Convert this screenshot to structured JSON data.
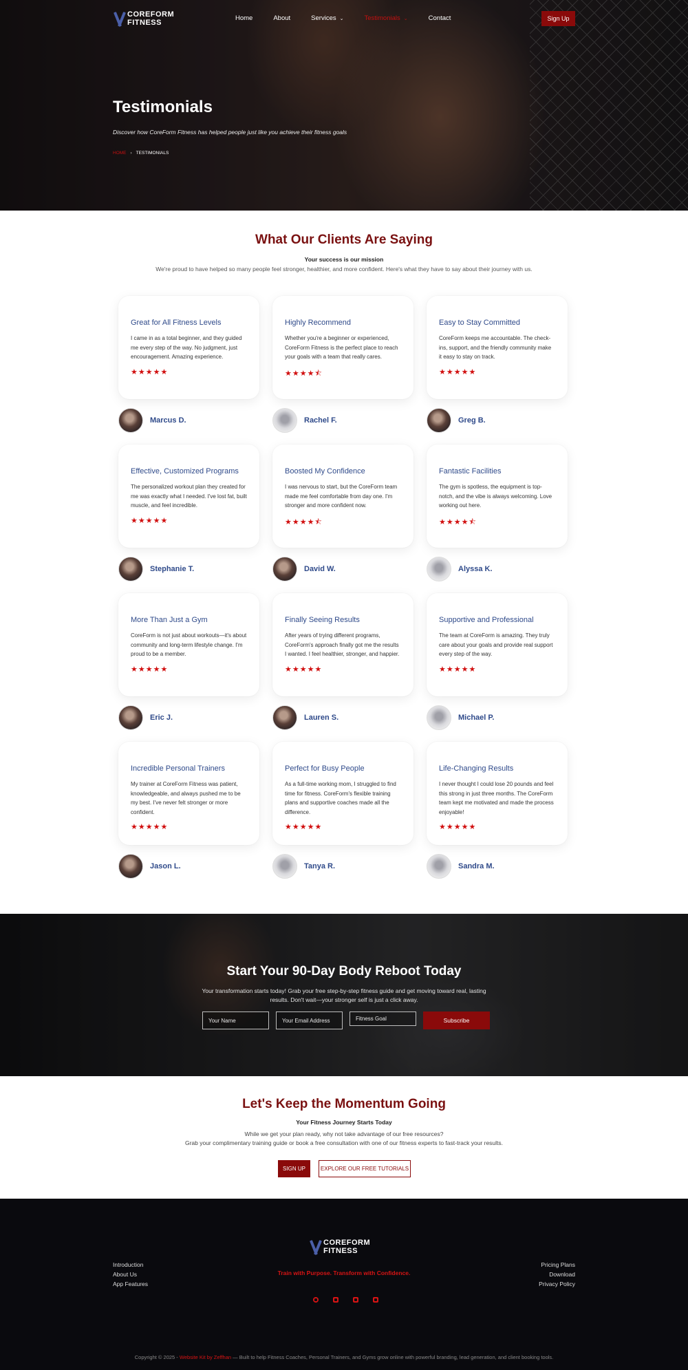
{
  "header": {
    "logo_line1": "COREFORM",
    "logo_line2": "FITNESS",
    "nav": [
      "Home",
      "About",
      "Services",
      "Testimonials",
      "Contact"
    ],
    "signup": "Sign Up"
  },
  "hero": {
    "title": "Testimonials",
    "subtitle": "Discover how CoreForm Fitness has helped people just like you achieve their fitness goals",
    "breadcrumb_home": "HOME",
    "breadcrumb_sep": "›",
    "breadcrumb_current": "TESTIMONIALS"
  },
  "testimonials": {
    "title": "What Our Clients Are Saying",
    "tagline": "Your success is our mission",
    "description": "We're proud to have helped so many people feel stronger, healthier, and more confident. Here's what they have to say about their journey with us.",
    "items": [
      {
        "title": "Great for All Fitness Levels",
        "text": "I came in as a total beginner, and they guided me every step of the way. No judgment, just encouragement. Amazing experience.",
        "stars": "★★★★★",
        "name": "Marcus D."
      },
      {
        "title": "Highly Recommend",
        "text": "Whether you're a beginner or experienced, CoreForm Fitness is the perfect place to reach your goals with a team that really cares.",
        "stars": "★★★★⯪",
        "name": "Rachel F."
      },
      {
        "title": "Easy to Stay Committed",
        "text": "CoreForm keeps me accountable. The check-ins, support, and the friendly community make it easy to stay on track.",
        "stars": "★★★★★",
        "name": "Greg B."
      },
      {
        "title": "Effective, Customized Programs",
        "text": "The personalized workout plan they created for me was exactly what I needed. I've lost fat, built muscle, and feel incredible.",
        "stars": "★★★★★",
        "name": "Stephanie T."
      },
      {
        "title": "Boosted My Confidence",
        "text": "I was nervous to start, but the CoreForm team made me feel comfortable from day one. I'm stronger and more confident now.",
        "stars": "★★★★⯪",
        "name": "David W."
      },
      {
        "title": "Fantastic Facilities",
        "text": "The gym is spotless, the equipment is top-notch, and the vibe is always welcoming. Love working out here.",
        "stars": "★★★★⯪",
        "name": "Alyssa K."
      },
      {
        "title": "More Than Just a Gym",
        "text": "CoreForm is not just about workouts—it's about community and long-term lifestyle change. I'm proud to be a member.",
        "stars": "★★★★★",
        "name": "Eric J."
      },
      {
        "title": "Finally Seeing Results",
        "text": "After years of trying different programs, CoreForm's approach finally got me the results I wanted. I feel healthier, stronger, and happier.",
        "stars": "★★★★★",
        "name": "Lauren S."
      },
      {
        "title": "Supportive and Professional",
        "text": "The team at CoreForm is amazing. They truly care about your goals and provide real support every step of the way.",
        "stars": "★★★★★",
        "name": "Michael P."
      },
      {
        "title": "Incredible Personal Trainers",
        "text": "My trainer at CoreForm Fitness was patient, knowledgeable, and always pushed me to be my best. I've never felt stronger or more confident.",
        "stars": "★★★★★",
        "name": "Jason L."
      },
      {
        "title": "Perfect for Busy People",
        "text": "As a full-time working mom, I struggled to find time for fitness. CoreForm's flexible training plans and supportive coaches made all the difference.",
        "stars": "★★★★★",
        "name": "Tanya R."
      },
      {
        "title": "Life-Changing Results",
        "text": "I never thought I could lose 20 pounds and feel this strong in just three months. The CoreForm team kept me motivated and made the process enjoyable!",
        "stars": "★★★★★",
        "name": "Sandra M."
      }
    ]
  },
  "reboot": {
    "title": "Start Your 90-Day Body Reboot Today",
    "text": "Your transformation starts today! Grab your free step-by-step fitness guide and get moving toward real, lasting results. Don't wait—your stronger self is just a click away.",
    "name_placeholder": "Your Name",
    "email_placeholder": "Your Email Address",
    "goal_placeholder": "Fitness Goal",
    "subscribe": "Subscribe"
  },
  "momentum": {
    "title": "Let's Keep the Momentum Going",
    "tagline": "Your Fitness Journey Starts Today",
    "line1": "While we get your plan ready, why not take advantage of our free resources?",
    "line2": "Grab your complimentary training guide or book a free consultation with one of our fitness experts to fast-track your results.",
    "signup": "SIGN UP",
    "tutorials": "EXPLORE OUR FREE TUTORIALS"
  },
  "footer": {
    "logo_line1": "COREFORM",
    "logo_line2": "FITNESS",
    "tagline": "Train with Purpose. Transform with Confidence.",
    "left_links": [
      "Introduction",
      "About Us",
      "App Features"
    ],
    "right_links": [
      "Pricing Plans",
      "Download",
      "Privacy Policy"
    ],
    "socials": [
      "facebook-icon",
      "instagram-icon",
      "linkedin-icon",
      "youtube-icon"
    ],
    "copyright_prefix": "Copyright © 2025 - ",
    "copyright_kit": "Website Kit by Zeffhan",
    "copyright_suffix": " — Built to help Fitness Coaches, Personal Trainers, and Gyms grow online with powerful branding, lead generation, and client booking tools."
  },
  "colors": {
    "brand_red": "#8a0a0a",
    "accent_red": "#d10f0f",
    "title_blue": "#2f4a8a"
  }
}
